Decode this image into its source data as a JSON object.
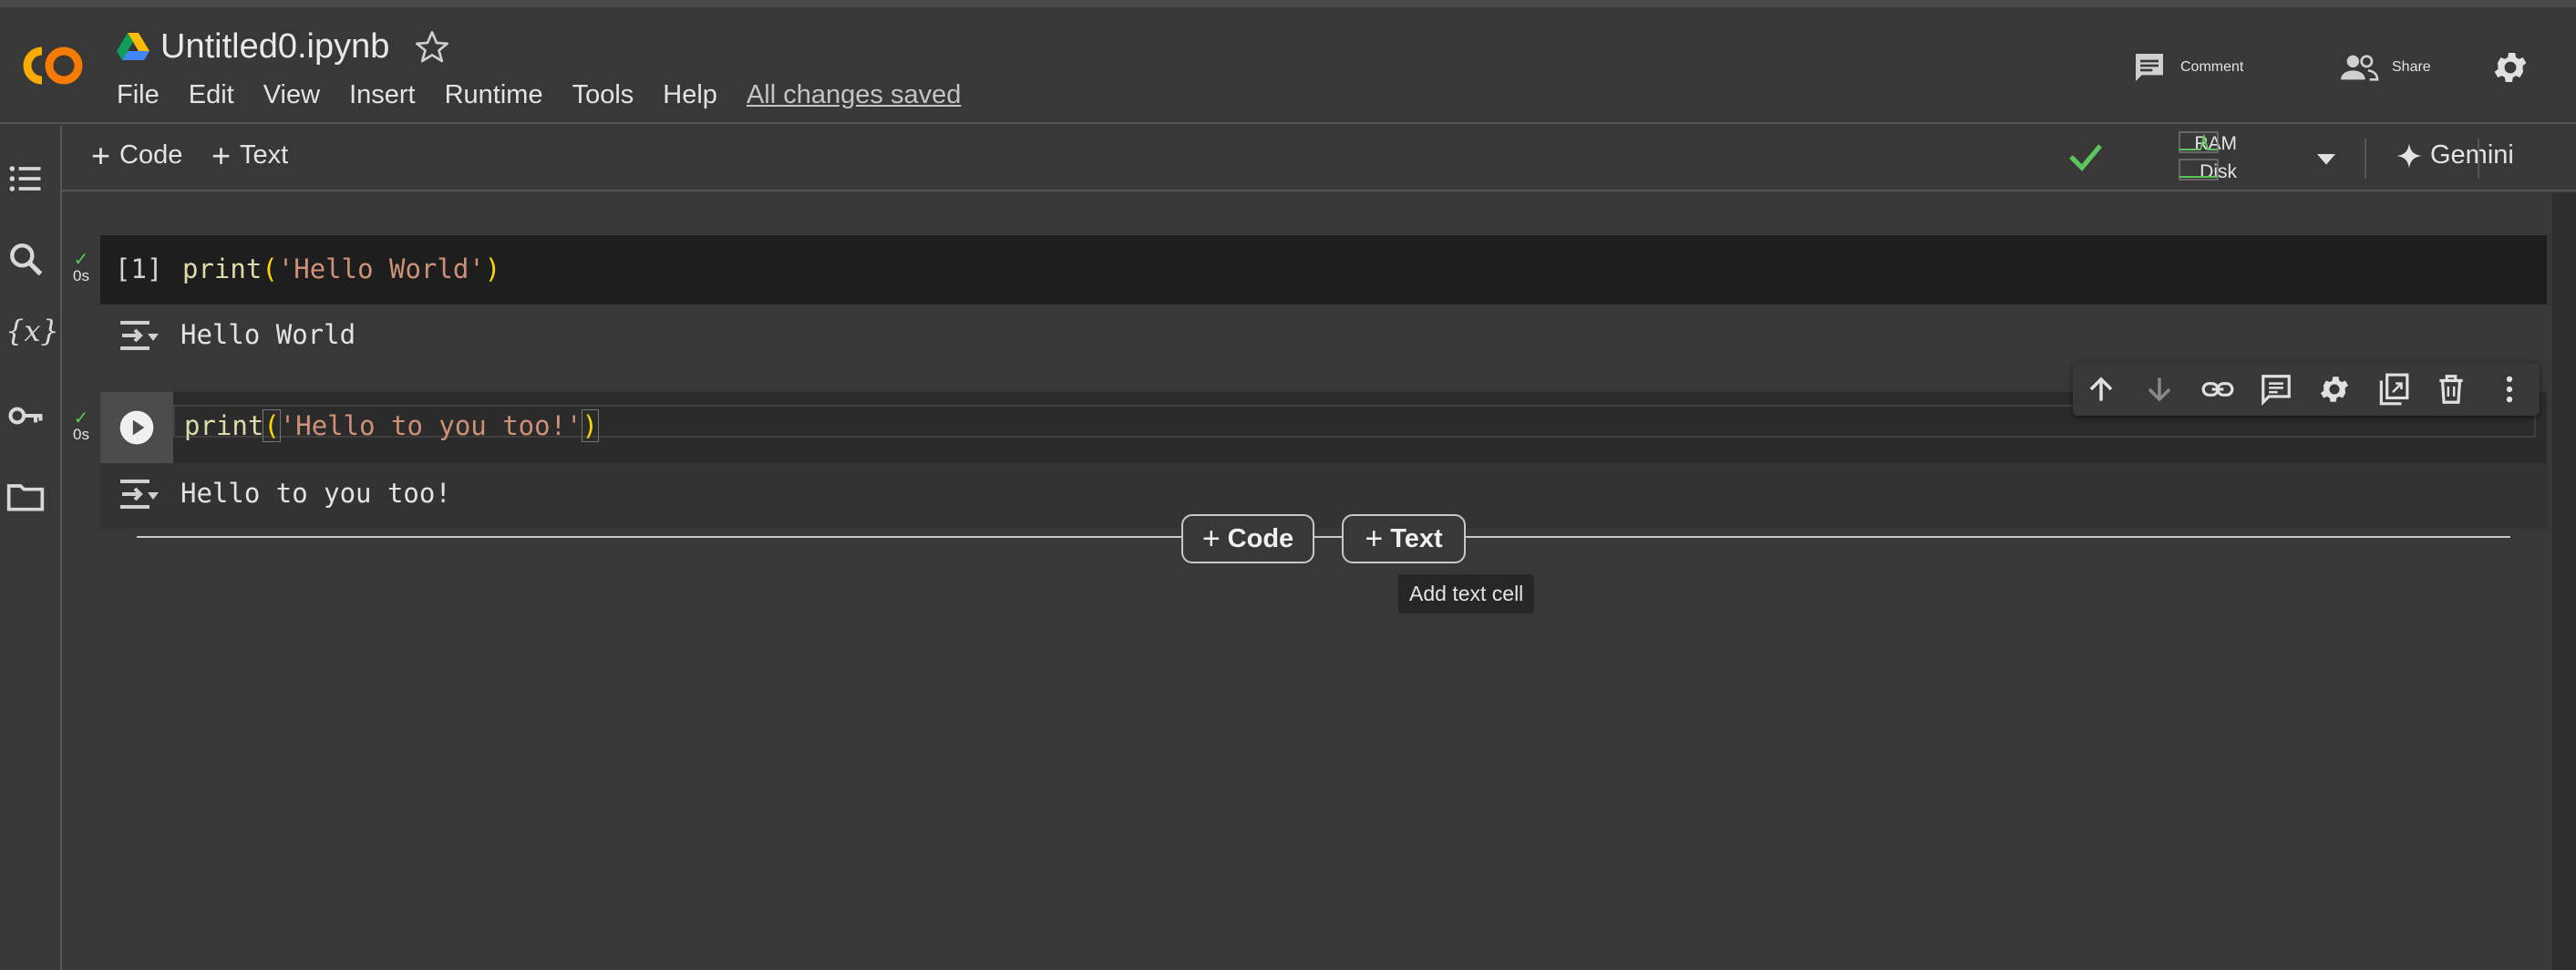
{
  "header": {
    "title": "Untitled0.ipynb",
    "menu": [
      "File",
      "Edit",
      "View",
      "Insert",
      "Runtime",
      "Tools",
      "Help"
    ],
    "save_status": "All changes saved",
    "comment_label": "Comment",
    "share_label": "Share"
  },
  "toolbar": {
    "add_code_label": "Code",
    "add_text_label": "Text",
    "ram_label": "RAM",
    "disk_label": "Disk",
    "gemini_label": "Gemini"
  },
  "cells": [
    {
      "exec_count": "[1]",
      "code_fn": "print",
      "code_str": "'Hello World'",
      "duration": "0s",
      "output": "Hello World"
    },
    {
      "code_fn": "print",
      "code_str": "'Hello to you too!'",
      "duration": "0s",
      "output": "Hello to you too!"
    }
  ],
  "add_cell": {
    "code_label": "Code",
    "text_label": "Text",
    "tooltip": "Add text cell"
  },
  "colors": {
    "background": "#383838",
    "code_cell": "#1e1e1e",
    "success": "#5cc65c",
    "logo_orange": "#f9ab00"
  }
}
